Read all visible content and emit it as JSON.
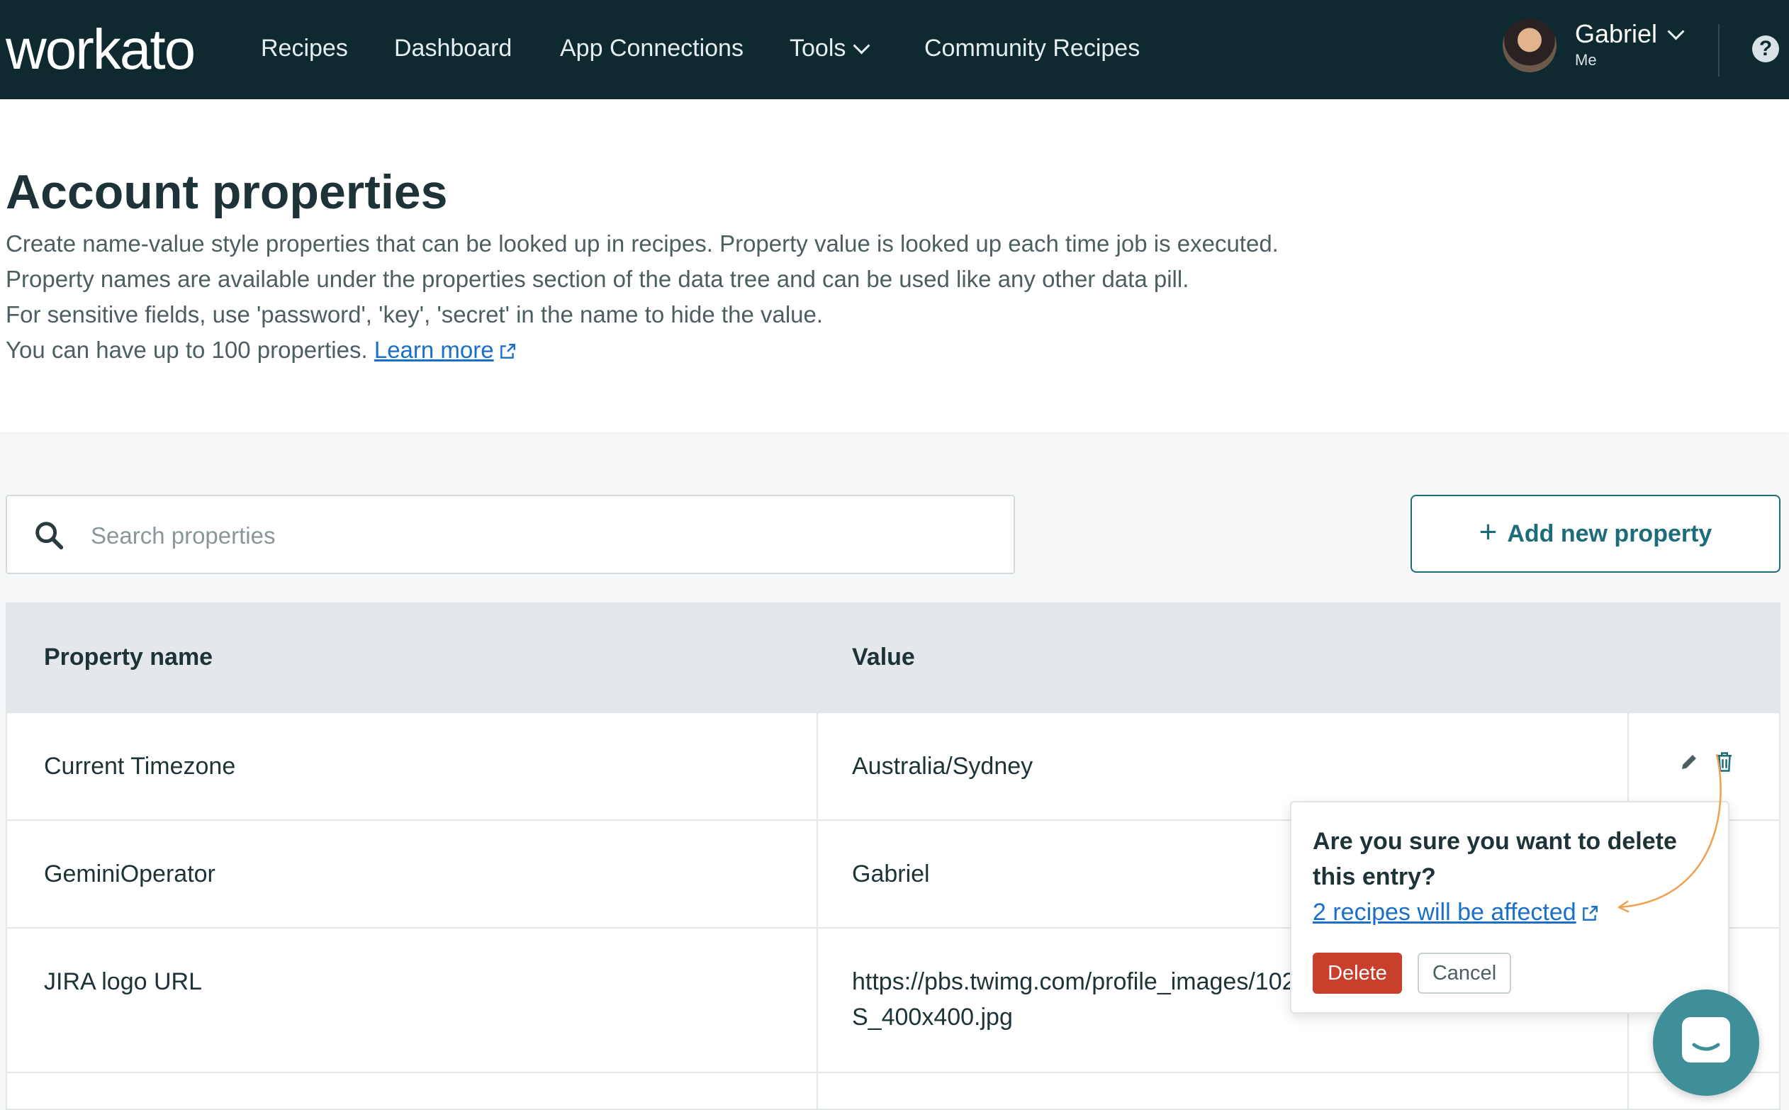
{
  "nav": {
    "logo": "workato",
    "items": [
      "Recipes",
      "Dashboard",
      "App Connections",
      "Tools",
      "Community Recipes"
    ],
    "user_name": "Gabriel",
    "user_sub": "Me",
    "help": "?"
  },
  "header": {
    "title": "Account properties",
    "lines": [
      "Create name-value style properties that can be looked up in recipes. Property value is looked up each time job is executed.",
      "Property names are available under the properties section of the data tree and can be used like any other data pill.",
      "For sensitive fields, use 'password', 'key', 'secret' in the name to hide the value.",
      "You can have up to 100 properties."
    ],
    "learn_more": "Learn more"
  },
  "search": {
    "placeholder": "Search properties"
  },
  "add_button": {
    "label": "Add new property"
  },
  "table": {
    "columns": [
      "Property name",
      "Value"
    ],
    "rows": [
      {
        "name": "Current Timezone",
        "value": "Australia/Sydney"
      },
      {
        "name": "GeminiOperator",
        "value": "Gabriel"
      },
      {
        "name": "JIRA logo URL",
        "value_line1": "https://pbs.twimg.com/profile_images/102",
        "value_line2": "S_400x400.jpg"
      }
    ]
  },
  "popover": {
    "question": "Are you sure you want to delete this entry?",
    "link": "2 recipes will be affected",
    "delete_label": "Delete",
    "cancel_label": "Cancel"
  },
  "colors": {
    "nav_bg": "#0e2a30",
    "accent": "#1c6d79",
    "link": "#1a6fc9",
    "danger": "#c8402b",
    "annotation": "#f0a050",
    "chat": "#3f8f9a"
  }
}
